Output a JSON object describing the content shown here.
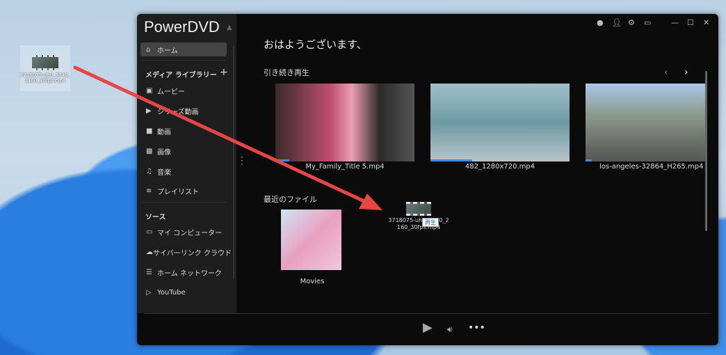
{
  "desktop": {
    "file_icon_label": "3718075-uhd_3840_2160_30fps.mp4"
  },
  "window": {
    "title": "PowerDVD"
  },
  "sidebar": {
    "home": "ホーム",
    "media_library": "メディア ライブラリー",
    "media_items": [
      {
        "icon": "movie-icon",
        "label": "ムービー"
      },
      {
        "icon": "series-icon",
        "label": "シリーズ動画"
      },
      {
        "icon": "video-icon",
        "label": "動画"
      },
      {
        "icon": "image-icon",
        "label": "画像"
      },
      {
        "icon": "music-icon",
        "label": "音楽"
      },
      {
        "icon": "playlist-icon",
        "label": "プレイリスト"
      }
    ],
    "sources": "ソース",
    "source_items": [
      {
        "icon": "computer-icon",
        "label": "マイ コンピューター"
      },
      {
        "icon": "cloud-icon",
        "label": "サイバーリンク クラウド"
      },
      {
        "icon": "network-icon",
        "label": "ホーム ネットワーク"
      },
      {
        "icon": "youtube-icon",
        "label": "YouTube"
      }
    ]
  },
  "main": {
    "greeting": "おはようございます、",
    "continue_title": "引き続き再生",
    "continue_items": [
      {
        "name": "My_Family_Title 5.mp4",
        "progress": 0.1
      },
      {
        "name": "482_1280x720.mp4",
        "progress": 0.3
      },
      {
        "name": "los-angeles-32864_H265.mp4",
        "progress": 0.05
      }
    ],
    "recent_title": "最近のファイル",
    "recent_items": [
      {
        "name": "Movies"
      }
    ],
    "drag_label": "3718075-uhd_3840_2160_30fps.mp4",
    "drag_tooltip": "再生"
  },
  "colors": {
    "accent": "#3a8fe0",
    "arrow": "#e84545"
  }
}
